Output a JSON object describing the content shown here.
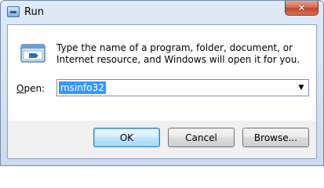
{
  "window": {
    "title": "Run",
    "close_label": "✕"
  },
  "dialog": {
    "description": "Type the name of a program, folder, document, or Internet resource, and Windows will open it for you.",
    "open_label": "pen:",
    "open_label_hotkey": "O",
    "input_value": "msinfo32"
  },
  "buttons": {
    "ok": "OK",
    "cancel": "Cancel",
    "browse": "Browse..."
  },
  "icons": {
    "title_icon": "run-icon",
    "dialog_icon": "run-program-icon",
    "dropdown_icon": "chevron-down-icon"
  }
}
